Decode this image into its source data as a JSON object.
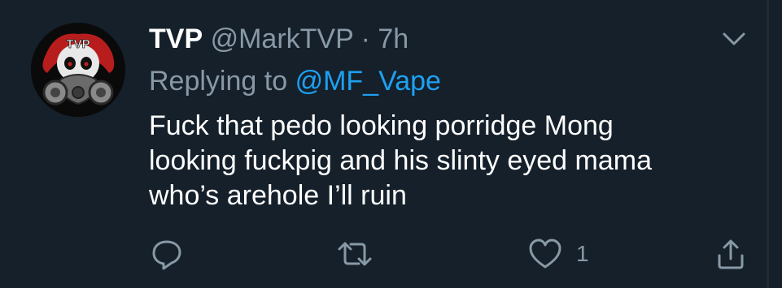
{
  "tweet": {
    "author_name": "TVP",
    "handle": "@MarkTVP",
    "separator": "·",
    "time": "7h",
    "replying_prefix": "Replying to",
    "replying_handle": "@MF_Vape",
    "body_lines": [
      "Fuck that pedo looking porridge Mong",
      "looking fuckpig and his slinty eyed mama",
      "who’s arehole I’ll ruin"
    ],
    "avatar_text": "TVP"
  },
  "actions": {
    "reply_icon": "speech-bubble-icon",
    "retweet_icon": "retweet-icon",
    "like_icon": "heart-icon",
    "like_count": "1",
    "share_icon": "share-upload-icon"
  },
  "colors": {
    "background": "#15202b",
    "secondary_text": "#8899a6",
    "link": "#1da1f2"
  }
}
